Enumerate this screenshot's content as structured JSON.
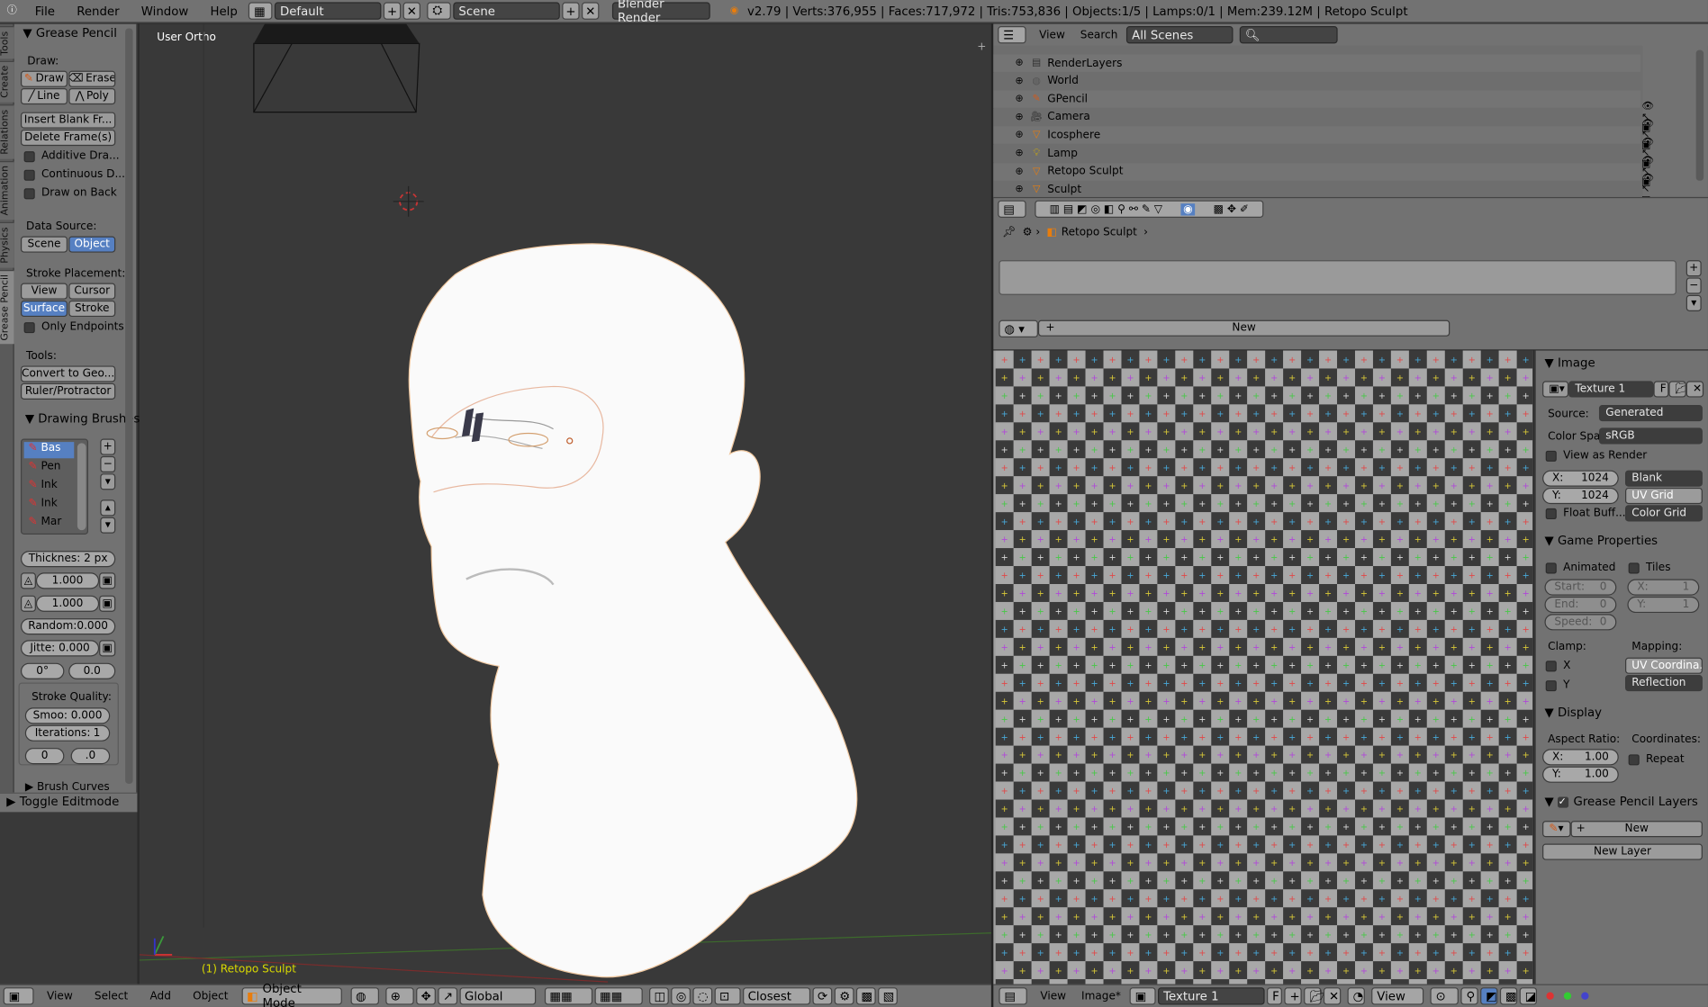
{
  "topbar": {
    "menus": [
      "File",
      "Render",
      "Window",
      "Help"
    ],
    "layout": "Default",
    "scene": "Scene",
    "engine": "Blender Render",
    "stats": "v2.79 | Verts:376,955 | Faces:717,972 | Tris:753,836 | Objects:1/5 | Lamps:0/1 | Mem:239.12M | Retopo Sculpt"
  },
  "tabs": [
    "Tools",
    "Create",
    "Relations",
    "Animation",
    "Physics",
    "Grease Pencil"
  ],
  "shelf": {
    "title": "Grease Pencil",
    "draw_label": "Draw:",
    "draw": "Draw",
    "erase": "Erase",
    "line": "Line",
    "poly": "Poly",
    "insert_blank": "Insert Blank Fr...",
    "delete_frames": "Delete Frame(s)",
    "additive": "Additive Dra...",
    "continuous": "Continuous D...",
    "draw_on_back": "Draw on Back",
    "data_source_label": "Data Source:",
    "scene": "Scene",
    "object": "Object",
    "stroke_placement_label": "Stroke Placement:",
    "view": "View",
    "cursor": "Cursor",
    "surface": "Surface",
    "stroke": "Stroke",
    "only_endpoints": "Only Endpoints",
    "tools_label": "Tools:",
    "convert": "Convert to Geo...",
    "ruler": "Ruler/Protractor",
    "brushes_title": "Drawing Brushes",
    "brushes": [
      "Bas",
      "Pen",
      "Ink",
      "Ink",
      "Mar"
    ],
    "thickness": "Thicknes: 2 px",
    "pressure1": "1.000",
    "pressure2": "1.000",
    "random": "Random:0.000",
    "jitter": "Jitte: 0.000",
    "angle": "0°",
    "angle_factor": "0.0",
    "stroke_quality_label": "Stroke Quality:",
    "smooth": "Smoo: 0.000",
    "iterations_label": "Iterations:",
    "iterations_value": "1",
    "sub1": "0",
    "sub2": ".0",
    "brush_curves": "Brush Curves",
    "toggle_editmode": "Toggle Editmode"
  },
  "viewport": {
    "view_label": "User Ortho",
    "object_label": "(1) Retopo Sculpt"
  },
  "viewport_header": {
    "view": "View",
    "select": "Select",
    "add": "Add",
    "object": "Object",
    "mode": "Object Mode",
    "orientation": "Global",
    "snap": "Closest"
  },
  "outliner": {
    "view": "View",
    "search": "Search",
    "scenes": "All Scenes",
    "rows": [
      {
        "name": "RenderLayers",
        "icon": "renderlayers-icon"
      },
      {
        "name": "World",
        "icon": "world-icon"
      },
      {
        "name": "GPencil",
        "icon": "gpencil-icon"
      },
      {
        "name": "Camera",
        "icon": "camera-icon"
      },
      {
        "name": "Icosphere",
        "icon": "mesh-icon"
      },
      {
        "name": "Lamp",
        "icon": "lamp-icon"
      },
      {
        "name": "Retopo Sculpt",
        "icon": "mesh-icon"
      },
      {
        "name": "Sculpt",
        "icon": "mesh-icon"
      }
    ]
  },
  "properties": {
    "breadcrumb": "Retopo Sculpt",
    "new_button": "New"
  },
  "image_panel": {
    "image_title": "Image",
    "texture_name": "Texture 1",
    "fake_user": "F",
    "source_label": "Source:",
    "source_value": "Generated",
    "color_space_label": "Color Spa",
    "color_space_value": "sRGB",
    "view_as_render": "View as Render",
    "x_label": "X:",
    "x_value": "1024",
    "y_label": "Y:",
    "y_value": "1024",
    "blank": "Blank",
    "uv_grid": "UV Grid",
    "color_grid": "Color Grid",
    "float_buffer": "Float Buff...",
    "game_title": "Game Properties",
    "animated": "Animated",
    "tiles": "Tiles",
    "start": "Start:",
    "start_v": "0",
    "end": "End:",
    "end_v": "0",
    "speed": "Speed:",
    "speed_v": "0",
    "tx": "X:",
    "tx_v": "1",
    "ty": "Y:",
    "ty_v": "1",
    "clamp_label": "Clamp:",
    "mapping_label": "Mapping:",
    "clamp_x": "X",
    "clamp_y": "Y",
    "uv_coord": "UV Coordina...",
    "reflection": "Reflection",
    "display_title": "Display",
    "aspect_label": "Aspect Ratio:",
    "coords_label": "Coordinates:",
    "ax_label": "X:",
    "ax_value": "1.00",
    "ay_label": "Y:",
    "ay_value": "1.00",
    "repeat": "Repeat",
    "gp_layers_title": "Grease Pencil Layers",
    "gp_new": "New",
    "gp_new_layer": "New Layer"
  },
  "image_header": {
    "view": "View",
    "image": "Image*",
    "texture": "Texture 1",
    "fake_user": "F",
    "view2": "View"
  }
}
